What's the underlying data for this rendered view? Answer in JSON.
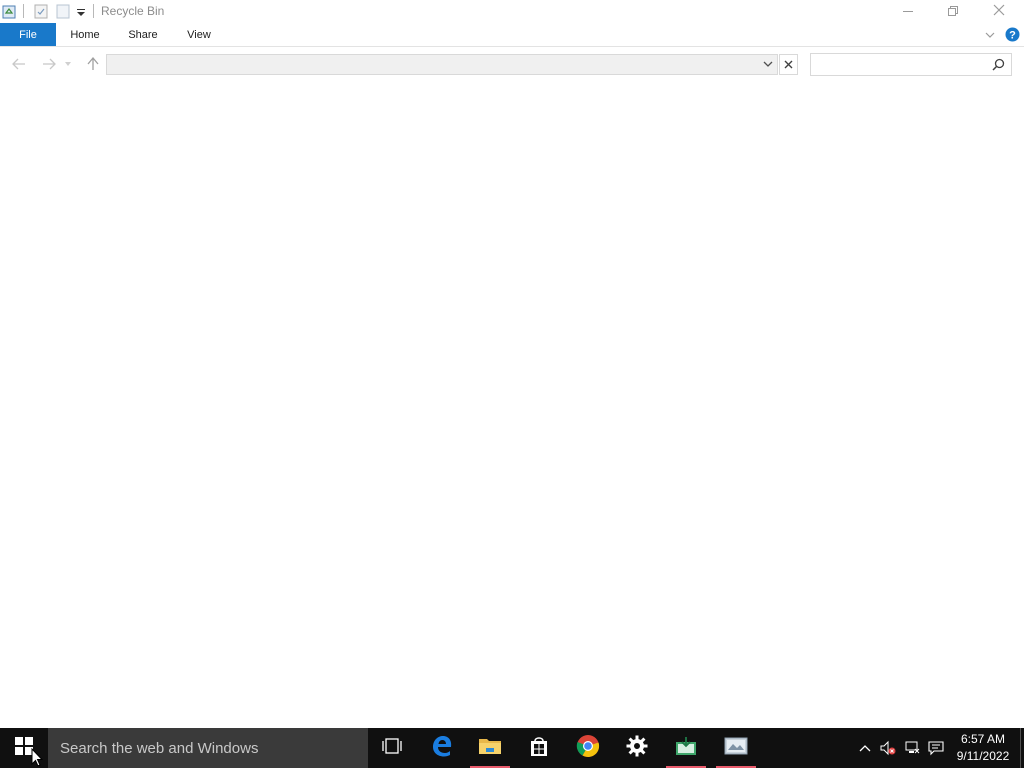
{
  "window": {
    "title": "Recycle Bin",
    "quick_access": [
      "recycle-bin-icon",
      "properties-icon",
      "new-folder-icon",
      "customize-dropdown-icon"
    ],
    "controls": [
      "minimize-icon",
      "restore-icon",
      "close-icon"
    ]
  },
  "ribbon": {
    "tabs": [
      {
        "label": "File",
        "name": "tab-file"
      },
      {
        "label": "Home",
        "name": "tab-home"
      },
      {
        "label": "Share",
        "name": "tab-share"
      },
      {
        "label": "View",
        "name": "tab-view"
      }
    ]
  },
  "navigation": {
    "address_value": "",
    "search_placeholder": ""
  },
  "taskbar": {
    "search_placeholder": "Search the web and Windows",
    "apps": [
      "task-view-icon",
      "edge-icon",
      "file-explorer-icon",
      "store-icon",
      "chrome-icon",
      "settings-icon",
      "app-icon",
      "photo-app-icon"
    ],
    "clock": {
      "time": "6:57 AM",
      "date": "9/11/2022"
    }
  },
  "colors": {
    "accent": "#1979ca",
    "taskbar": "#101010",
    "taskbar_search": "#3a3a3a",
    "running_indicator": "#e95b6c"
  }
}
